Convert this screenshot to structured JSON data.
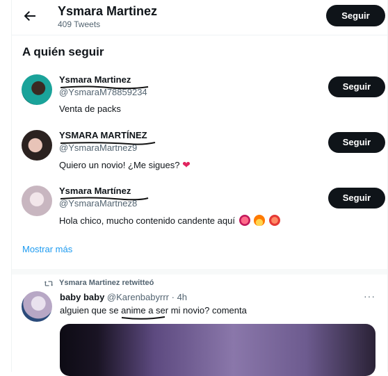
{
  "header": {
    "name": "Ysmara Martinez",
    "tweets": "409 Tweets",
    "follow_label": "Seguir"
  },
  "who_to_follow": {
    "title": "A quién seguir",
    "show_more": "Mostrar más",
    "users": [
      {
        "name": "Ysmara Martinez",
        "handle": "@YsmaraM78859234",
        "bio": "Venta de packs",
        "follow_label": "Seguir"
      },
      {
        "name": "YSMARA MARTÍNEZ",
        "handle": "@YsmaraMartnez9",
        "bio": "Quiero un novio! ¿Me sigues?",
        "follow_label": "Seguir"
      },
      {
        "name": "Ysmara Martínez",
        "handle": "@YsmaraMartnez8",
        "bio": "Hola chico, mucho contenido candente aquí",
        "follow_label": "Seguir"
      }
    ]
  },
  "tweet": {
    "retweet_text": "Ysmara Martinez retwitteó",
    "author_name": "baby baby",
    "author_handle": "@Karenbabyrrr",
    "time": "· 4h",
    "text": "alguien que se anime a ser mi novio? comenta",
    "more_label": "···"
  },
  "colors": {
    "accent": "#1d9bf0",
    "button": "#0f1419",
    "muted": "#536471"
  }
}
